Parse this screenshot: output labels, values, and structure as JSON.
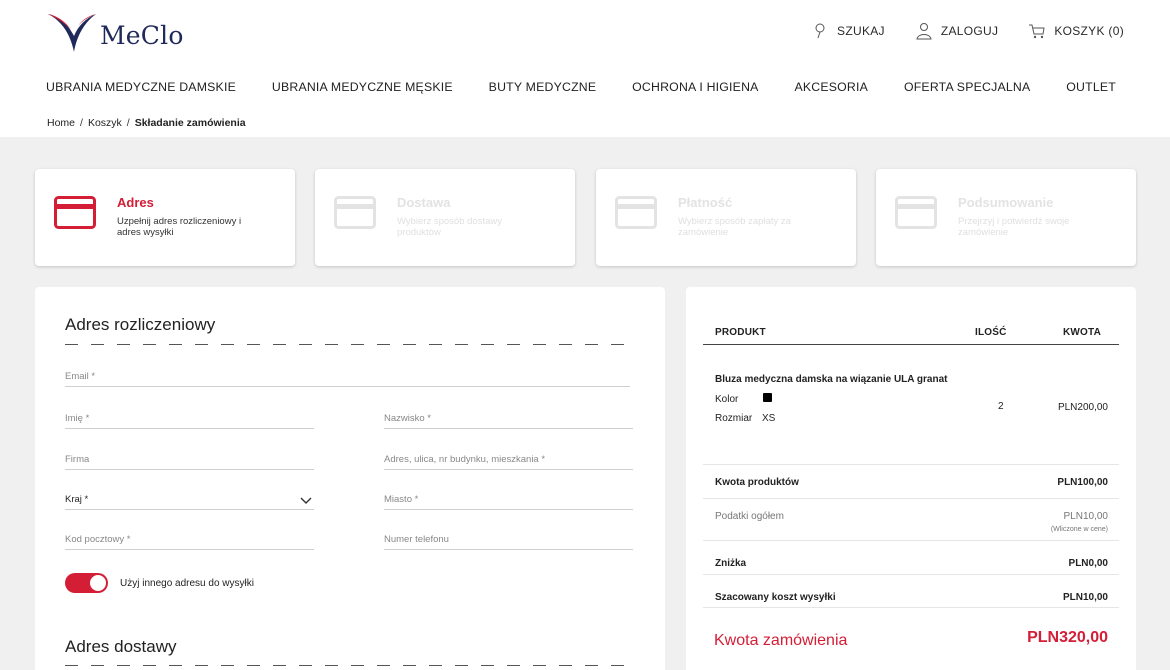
{
  "brand": {
    "name": "MeClo",
    "accent": "#d31e36",
    "navy": "#1f2a5a"
  },
  "top_actions": [
    {
      "icon": "pin-icon",
      "label": "SZUKAJ"
    },
    {
      "icon": "user-icon",
      "label": "ZALOGUJ"
    },
    {
      "icon": "cart-icon",
      "label": "KOSZYK (0)"
    }
  ],
  "nav": [
    "UBRANIA MEDYCZNE DAMSKIE",
    "UBRANIA MEDYCZNE MĘSKIE",
    "BUTY MEDYCZNE",
    "OCHRONA I HIGIENA",
    "AKCESORIA",
    "OFERTA SPECJALNA",
    "OUTLET"
  ],
  "breadcrumb": {
    "home": "Home",
    "sep": "/",
    "cart": "Koszyk",
    "current": "Składanie zamówienia"
  },
  "steps": [
    {
      "title": "Adres",
      "desc": "Uzpełnij adres rozliczeniowy i adres wysyłki",
      "active": true
    },
    {
      "title": "Dostawa",
      "desc": "Wybierz sposób dostawy produktów",
      "active": false
    },
    {
      "title": "Płatność",
      "desc": "Wybierz sposób zapłaty za zamówienie",
      "active": false
    },
    {
      "title": "Podsumowanie",
      "desc": "Przejrzyj i potwierdź swoje zamówienie",
      "active": false
    }
  ],
  "billing": {
    "title": "Adres rozliczeniowy",
    "fields": {
      "email": "Email *",
      "first_name": "Imię *",
      "last_name": "Nazwisko *",
      "company": "Firma",
      "address": "Adres, ulica, nr budynku, mieszkania *",
      "country": "Kraj *",
      "city": "Miasto *",
      "postal": "Kod pocztowy *",
      "phone": "Numer telefonu"
    },
    "toggle_label": "Użyj innego adresu do wysyłki",
    "toggle_on": true
  },
  "shipping": {
    "title": "Adres dostawy"
  },
  "summary": {
    "headers": {
      "product": "PRODUKT",
      "qty": "ILOŚĆ",
      "amount": "KWOTA"
    },
    "item": {
      "name": "Bluza medyczna damska na wiązanie ULA granat",
      "color_label": "Kolor",
      "color_value": "#000000",
      "size_label": "Rozmiar",
      "size_value": "XS",
      "qty": "2",
      "price": "PLN200,00"
    },
    "products_total_label": "Kwota produktów",
    "products_total": "PLN100,00",
    "tax_label": "Podatki ogółem",
    "tax_value": "PLN10,00",
    "tax_note": "(Wliczone w cene)",
    "discount_label": "Zniżka",
    "discount_value": "PLN0,00",
    "shipping_label": "Szacowany koszt wysyłki",
    "shipping_value": "PLN10,00",
    "order_total_label": "Kwota zamówienia",
    "order_total": "PLN320,00"
  }
}
